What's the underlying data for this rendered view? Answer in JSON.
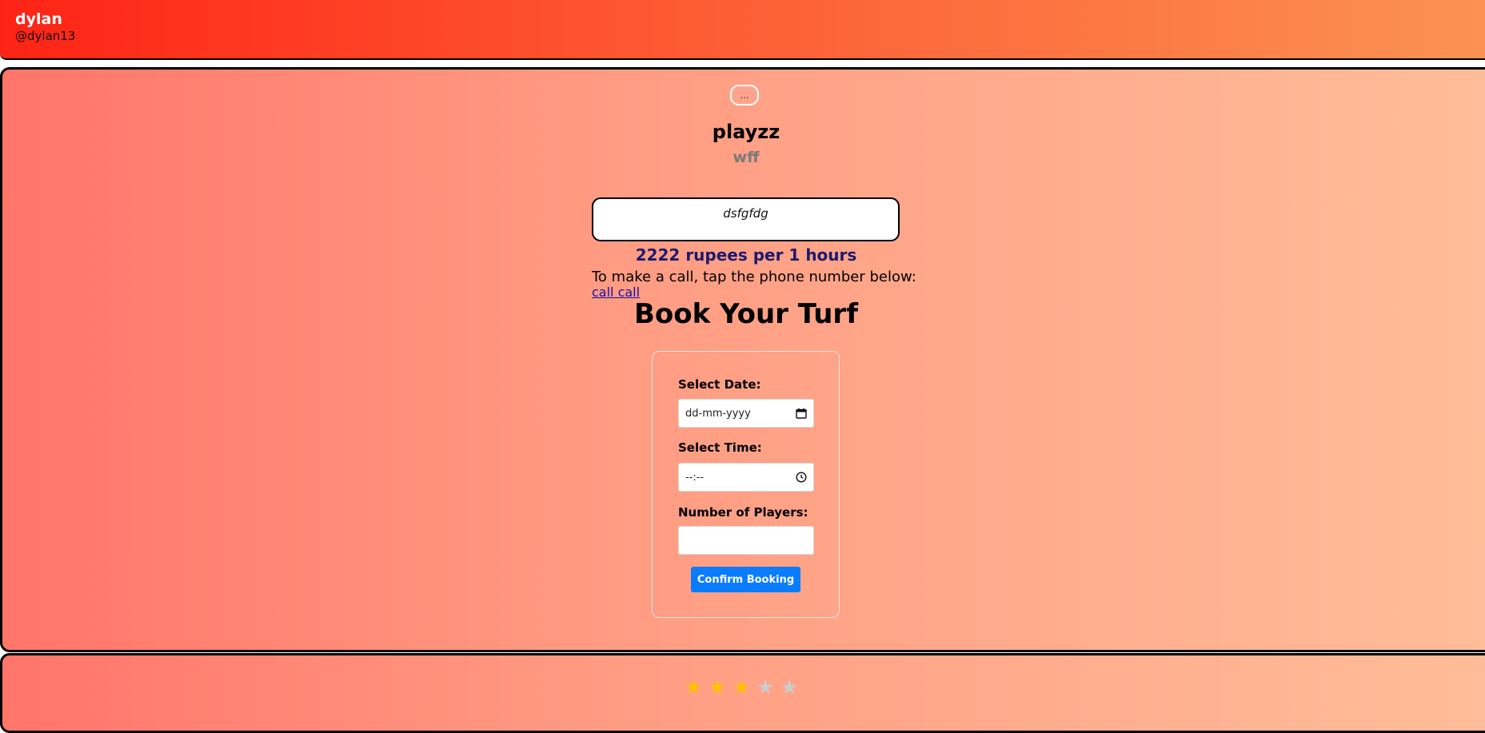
{
  "header": {
    "user_name": "dylan",
    "user_handle": "@dylan13"
  },
  "turf": {
    "image_alt": "...",
    "name": "playzz",
    "subtitle": "wff",
    "description": "dsfgfdg",
    "price_text": "2222 rupees per 1 hours",
    "call_hint": "To make a call, tap the phone number below:",
    "call_link": "call call"
  },
  "booking": {
    "title": "Book Your Turf",
    "date_label": "Select Date:",
    "date_placeholder": "dd-mm-yyyy",
    "time_label": "Select Time:",
    "time_placeholder": "--:--",
    "players_label": "Number of Players:",
    "players_value": "",
    "confirm_label": "Confirm Booking"
  },
  "rating": {
    "stars_total": 5,
    "stars_filled": 3,
    "filled_color": "#ffc400",
    "empty_color": "#cccccc"
  },
  "colors": {
    "header_gradient_start": "#fe2316",
    "header_gradient_end": "#fb9252",
    "card_gradient_start": "#ff7569",
    "card_gradient_end": "#ffbd98",
    "button_blue": "#0a7cff",
    "price_color": "#1c1a6e"
  }
}
